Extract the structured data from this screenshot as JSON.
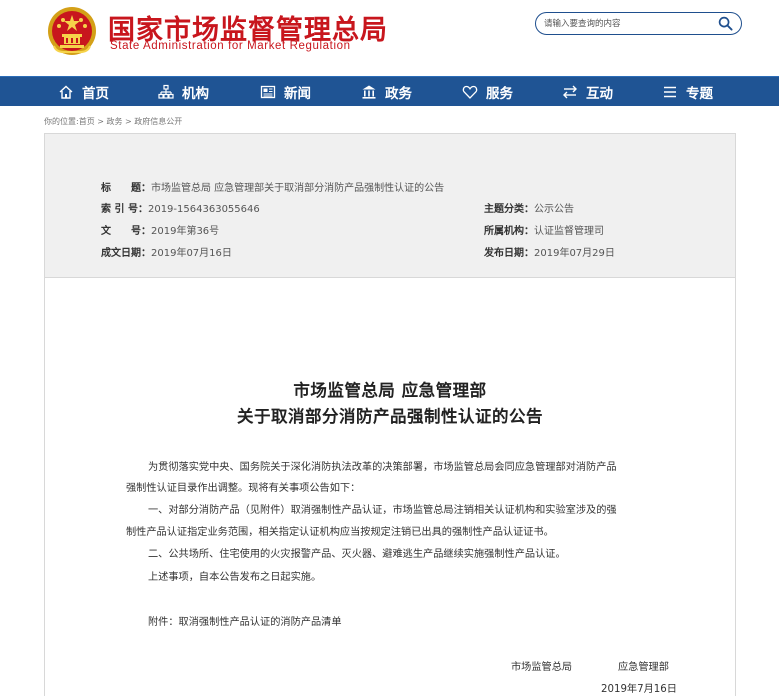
{
  "site": {
    "title_cn": "国家市场监督管理总局",
    "title_en": "State Administration for Market Regulation"
  },
  "search": {
    "placeholder": "请输入要查询的内容"
  },
  "nav": [
    {
      "label": "首页",
      "icon": "home-icon"
    },
    {
      "label": "机构",
      "icon": "org-chart-icon"
    },
    {
      "label": "新闻",
      "icon": "newspaper-icon"
    },
    {
      "label": "政务",
      "icon": "government-icon"
    },
    {
      "label": "服务",
      "icon": "heart-icon"
    },
    {
      "label": "互动",
      "icon": "exchange-icon"
    },
    {
      "label": "专题",
      "icon": "list-icon"
    }
  ],
  "breadcrumb": {
    "prefix": "你的位置:",
    "items": [
      "首页",
      "政务",
      "政府信息公开"
    ],
    "separator": " > "
  },
  "meta": {
    "title_key": "标　　题：",
    "title_val": "市场监管总局 应急管理部关于取消部分消防产品强制性认证的公告",
    "index_key": "索 引 号：",
    "index_val": "2019-1564363055646",
    "category_key": "主题分类：",
    "category_val": "公示公告",
    "docno_key": "文　　号：",
    "docno_val": "2019年第36号",
    "org_key": "所属机构：",
    "org_val": "认证监督管理司",
    "created_key": "成文日期：",
    "created_val": "2019年07月16日",
    "published_key": "发布日期：",
    "published_val": "2019年07月29日"
  },
  "article": {
    "title_line1": "市场监管总局  应急管理部",
    "title_line2": "关于取消部分消防产品强制性认证的公告",
    "p1_line1": "为贯彻落实党中央、国务院关于深化消防执法改革的决策部署，市场监管总局会同应急管理部对消防产品",
    "p1_line2": "强制性认证目录作出调整。现将有关事项公告如下：",
    "p2_line1": "一、对部分消防产品（见附件）取消强制性产品认证，市场监管总局注销相关认证机构和实验室涉及的强",
    "p2_line2": "制性产品认证指定业务范围，相关指定认证机构应当按规定注销已出具的强制性产品认证证书。",
    "p3": "二、公共场所、住宅使用的火灾报警产品、灭火器、避难逃生产品继续实施强制性产品认证。",
    "p4": "上述事项，自本公告发布之日起实施。",
    "attachment": "附件：取消强制性产品认证的消防产品清单",
    "sign_org1": "市场监管总局",
    "sign_org2": "应急管理部",
    "sign_date": "2019年7月16日"
  },
  "colors": {
    "brand_red": "#c8161d",
    "nav_blue": "#1f5494"
  }
}
